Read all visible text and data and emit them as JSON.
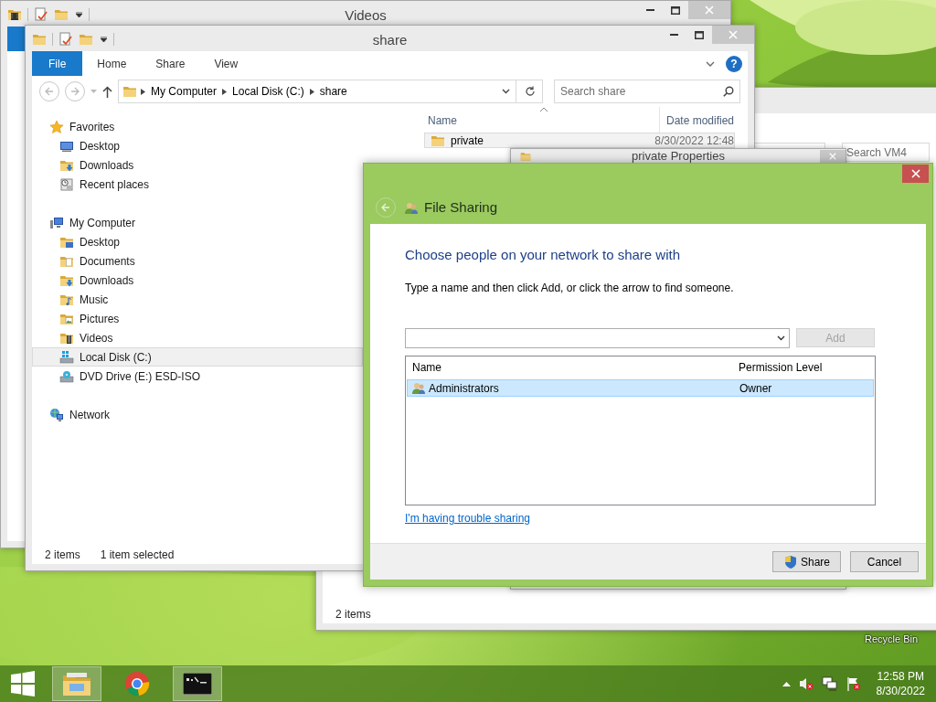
{
  "videos_window": {
    "title": "Videos"
  },
  "background_window": {
    "search_placeholder": "Search VM4",
    "status": "2 items"
  },
  "share_window": {
    "title": "share",
    "ribbon_tabs": [
      {
        "label": "File",
        "selected": true
      },
      {
        "label": "Home",
        "selected": false
      },
      {
        "label": "Share",
        "selected": false
      },
      {
        "label": "View",
        "selected": false
      }
    ],
    "help_button": "?",
    "breadcrumb": [
      "My Computer",
      "Local Disk (C:)",
      "share"
    ],
    "search_placeholder": "Search share",
    "nav": [
      {
        "label": "Favorites",
        "kind": "favorites",
        "selected": false,
        "children": [
          {
            "label": "Desktop",
            "kind": "desktop",
            "selected": false
          },
          {
            "label": "Downloads",
            "kind": "downloads",
            "selected": false
          },
          {
            "label": "Recent places",
            "kind": "recent",
            "selected": false
          }
        ]
      },
      {
        "label": "My Computer",
        "kind": "computer",
        "selected": false,
        "children": [
          {
            "label": "Desktop",
            "kind": "desktop_folder",
            "selected": false
          },
          {
            "label": "Documents",
            "kind": "documents",
            "selected": false
          },
          {
            "label": "Downloads",
            "kind": "downloads",
            "selected": false
          },
          {
            "label": "Music",
            "kind": "music",
            "selected": false
          },
          {
            "label": "Pictures",
            "kind": "pictures",
            "selected": false
          },
          {
            "label": "Videos",
            "kind": "videos",
            "selected": false
          },
          {
            "label": "Local Disk (C:)",
            "kind": "drive",
            "selected": true
          },
          {
            "label": "DVD Drive (E:) ESD-ISO",
            "kind": "dvd",
            "selected": false
          }
        ]
      },
      {
        "label": "Network",
        "kind": "network",
        "selected": false
      }
    ],
    "columns": [
      "Name",
      "Date modified"
    ],
    "files": [
      {
        "name": "private",
        "date": "8/30/2022 12:48",
        "selected": true
      }
    ],
    "status_bar": {
      "count": "2 items",
      "selection": "1 item selected"
    }
  },
  "properties_dialog": {
    "title": "private Properties"
  },
  "file_sharing": {
    "title": "File Sharing",
    "heading": "Choose people on your network to share with",
    "instruction": "Type a name and then click Add, or click the arrow to find someone.",
    "add_button": {
      "label": "Add",
      "disabled": true
    },
    "columns": [
      "Name",
      "Permission Level"
    ],
    "rows": [
      {
        "name": "Administrators",
        "permission": "Owner",
        "selected": true
      }
    ],
    "help_link": "I'm having trouble sharing",
    "buttons": [
      {
        "label": "Share",
        "kind": "shield"
      },
      {
        "label": "Cancel",
        "kind": "plain"
      }
    ]
  },
  "desktop": {
    "icon_label": "Recycle Bin"
  },
  "taskbar": {
    "apps": [
      {
        "kind": "explorer",
        "active": true
      },
      {
        "kind": "browser",
        "active": false
      },
      {
        "kind": "terminal",
        "active": true
      }
    ],
    "time": "12:58 PM",
    "date": "8/30/2022"
  }
}
